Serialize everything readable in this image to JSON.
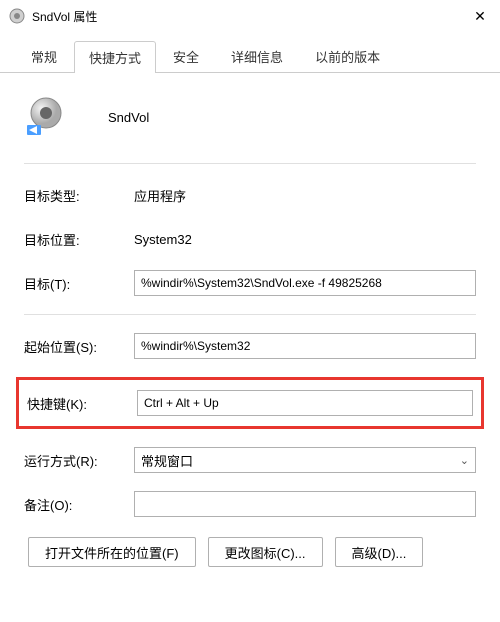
{
  "titlebar": {
    "title": "SndVol 属性"
  },
  "tabs": {
    "general": "常规",
    "shortcut": "快捷方式",
    "security": "安全",
    "details": "详细信息",
    "previous": "以前的版本"
  },
  "header": {
    "app_name": "SndVol"
  },
  "fields": {
    "target_type_label": "目标类型:",
    "target_type_value": "应用程序",
    "target_location_label": "目标位置:",
    "target_location_value": "System32",
    "target_label": "目标(T):",
    "target_value": "%windir%\\System32\\SndVol.exe -f 49825268",
    "start_in_label": "起始位置(S):",
    "start_in_value": "%windir%\\System32",
    "shortcut_key_label": "快捷键(K):",
    "shortcut_key_value": "Ctrl + Alt + Up",
    "run_label": "运行方式(R):",
    "run_value": "常规窗口",
    "comment_label": "备注(O):",
    "comment_value": ""
  },
  "buttons": {
    "open_location": "打开文件所在的位置(F)",
    "change_icon": "更改图标(C)...",
    "advanced": "高级(D)..."
  }
}
